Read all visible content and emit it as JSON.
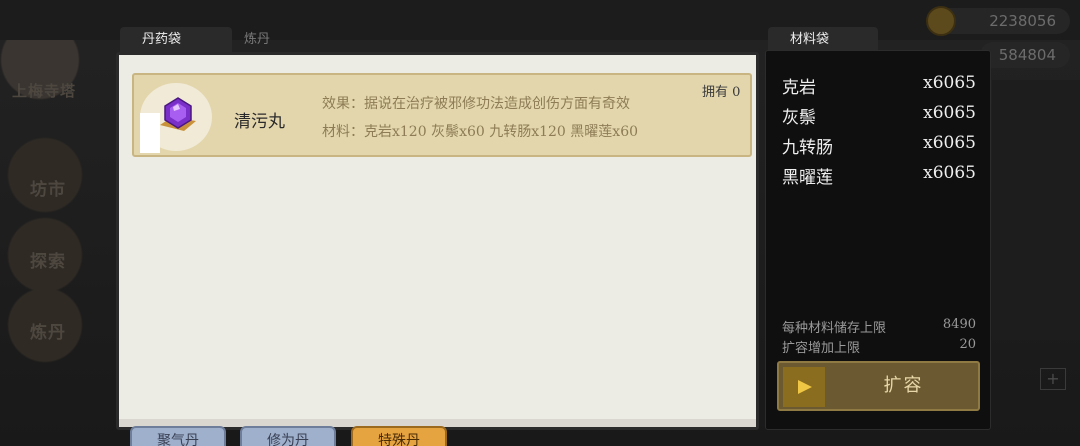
{
  "background": {
    "left_labels": [
      "上梅寺塔",
      "坊市",
      "探索",
      "炼丹"
    ],
    "currency_1": "2238056",
    "currency_2": "584804"
  },
  "main_panel": {
    "tab_active": "丹药袋",
    "tab_inactive": "炼丹",
    "items": [
      {
        "name": "清污丸",
        "effect": "效果：据说在治疗被邪修功法造成创伤方面有奇效",
        "materials": "材料：克岩x120 灰鬃x60 九转肠x120 黑曜莲x60",
        "owned": "拥有 0",
        "icon": "purple-gem-icon"
      }
    ]
  },
  "bottom_tabs": [
    {
      "label": "聚气丹",
      "color": "#9fb0cc"
    },
    {
      "label": "修为丹",
      "color": "#9fb0cc"
    },
    {
      "label": "特殊丹",
      "color": "#e6a440"
    }
  ],
  "material_bag": {
    "title": "材料袋",
    "materials": [
      {
        "name": "克岩",
        "qty": "x6065"
      },
      {
        "name": "灰鬃",
        "qty": "x6065"
      },
      {
        "name": "九转肠",
        "qty": "x6065"
      },
      {
        "name": "黑曜莲",
        "qty": "x6065"
      }
    ],
    "storage_limit_label": "每种材料储存上限",
    "storage_limit_value": "8490",
    "expand_limit_label": "扩容增加上限",
    "expand_limit_value": "20",
    "expand_button": "扩容"
  }
}
